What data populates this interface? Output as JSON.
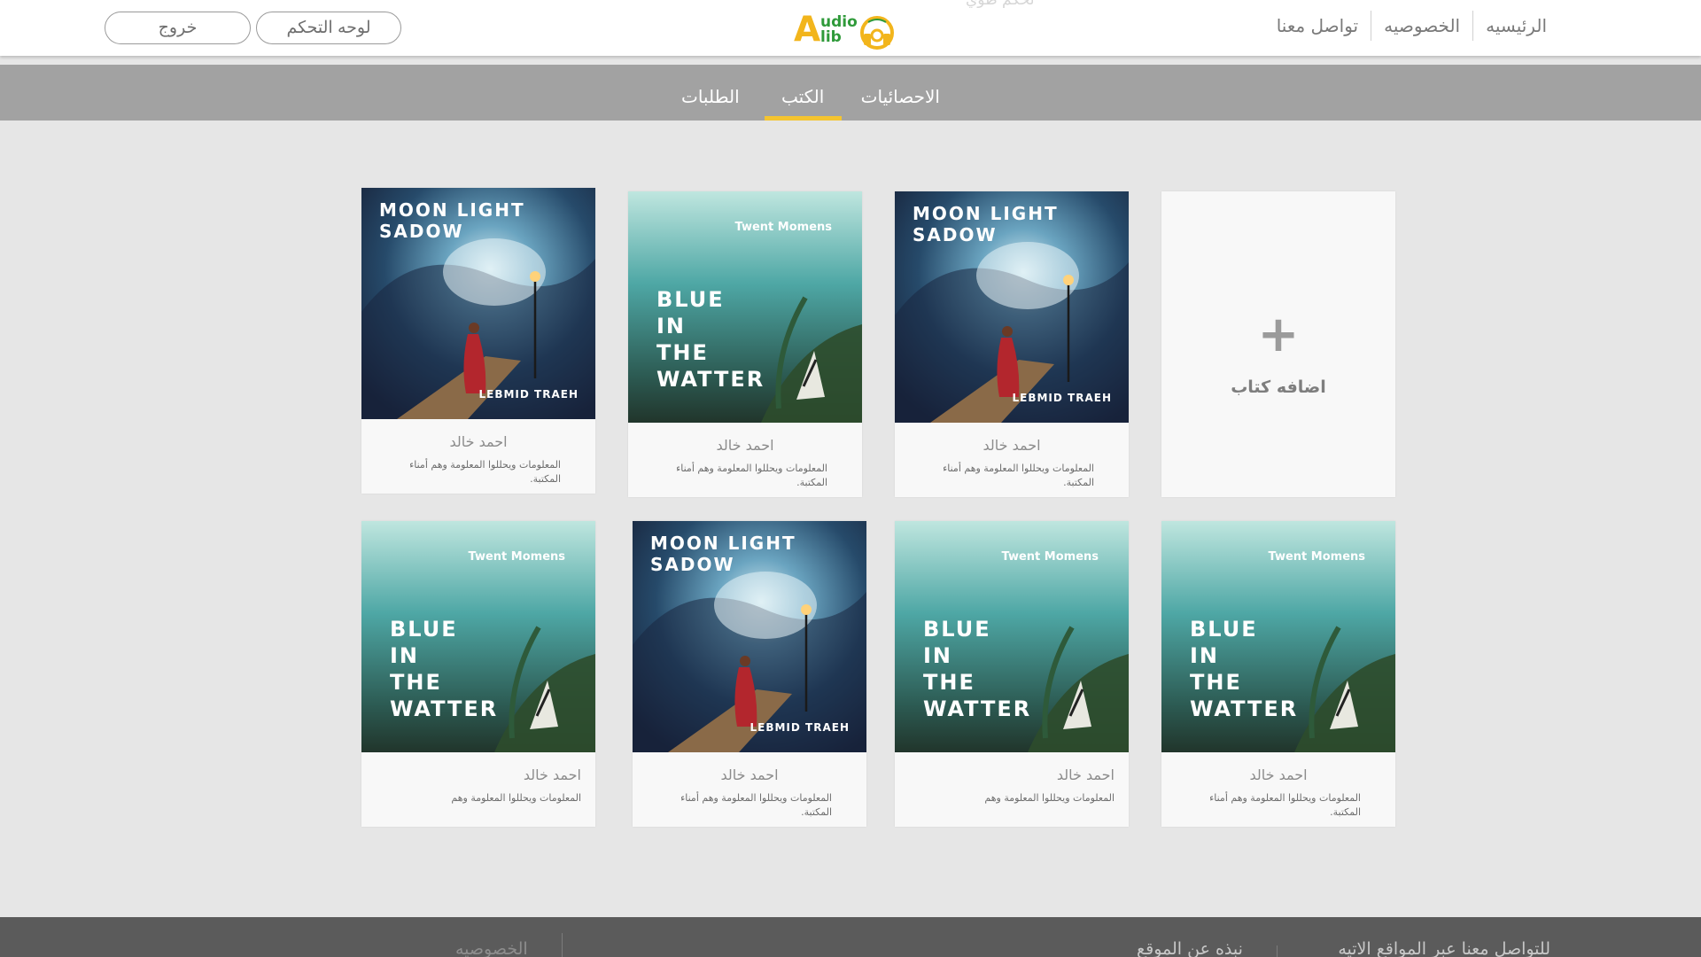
{
  "header": {
    "ghost_text": "تحكم طوي",
    "nav": [
      {
        "label": "الرئيسيه"
      },
      {
        "label": "الخصوصيه"
      },
      {
        "label": "تواصل معنا"
      }
    ],
    "dashboard_button": "لوحه التحكم",
    "logout_button": "خروج",
    "logo": {
      "letter": "A",
      "word1": "udio",
      "word2": "lib"
    }
  },
  "tabs": [
    {
      "label": "الاحصائيات",
      "active": false
    },
    {
      "label": "الكتب",
      "active": true
    },
    {
      "label": "الطلبات",
      "active": false
    }
  ],
  "add_book_label": "اضافه كتاب",
  "books": [
    {
      "cover": "moon",
      "title_line1": "MOON LIGHT",
      "title_line2": "SADOW",
      "cover_author": "LEBMID TRAEH",
      "author": "احمد خالد",
      "description": "المعلومات ويحللوا المعلومة وهم أمناء المكتبة."
    },
    {
      "cover": "blue",
      "tagline": "Twent Momens",
      "title_lines": [
        "BLUE",
        "IN",
        "THE",
        "WATTER"
      ],
      "author": "احمد خالد",
      "description": "المعلومات ويحللوا المعلومة وهم أمناء المكتبة."
    },
    {
      "cover": "moon",
      "title_line1": "MOON LIGHT",
      "title_line2": "SADOW",
      "cover_author": "LEBMID TRAEH",
      "author": "احمد خالد",
      "description": "المعلومات ويحللوا المعلومة وهم أمناء المكتبة."
    },
    {
      "cover": "blue",
      "tagline": "Twent Momens",
      "title_lines": [
        "BLUE",
        "IN",
        "THE",
        "WATTER"
      ],
      "author": "احمد خالد",
      "description": "المعلومات ويحللوا المعلومة وهم"
    },
    {
      "cover": "moon",
      "title_line1": "MOON LIGHT",
      "title_line2": "SADOW",
      "cover_author": "LEBMID TRAEH",
      "author": "احمد خالد",
      "description": "المعلومات ويحللوا المعلومة وهم أمناء المكتبة."
    },
    {
      "cover": "blue",
      "tagline": "Twent Momens",
      "title_lines": [
        "BLUE",
        "IN",
        "THE",
        "WATTER"
      ],
      "author": "احمد خالد",
      "description": "المعلومات ويحللوا المعلومة وهم"
    },
    {
      "cover": "blue",
      "tagline": "Twent Momens",
      "title_lines": [
        "BLUE",
        "IN",
        "THE",
        "WATTER"
      ],
      "author": "احمد خالد",
      "description": "المعلومات ويحللوا المعلومة وهم أمناء المكتبة."
    }
  ],
  "footer": {
    "follow_label": "للتواصل معنا عبر المواقع الاتيه",
    "about_label": "نبذه عن الموقع",
    "privacy_label": "الخصوصيه"
  },
  "colors": {
    "accent": "#f4c430",
    "logo_green": "#2f9a3a",
    "logo_yellow": "#f2b51c",
    "tabbar": "#a2a2a2",
    "footer": "#5b5b5b",
    "page_background": "#e6e6e6"
  },
  "icons": {
    "logo_icon": "headphones-icon",
    "add_icon": "plus-icon"
  }
}
